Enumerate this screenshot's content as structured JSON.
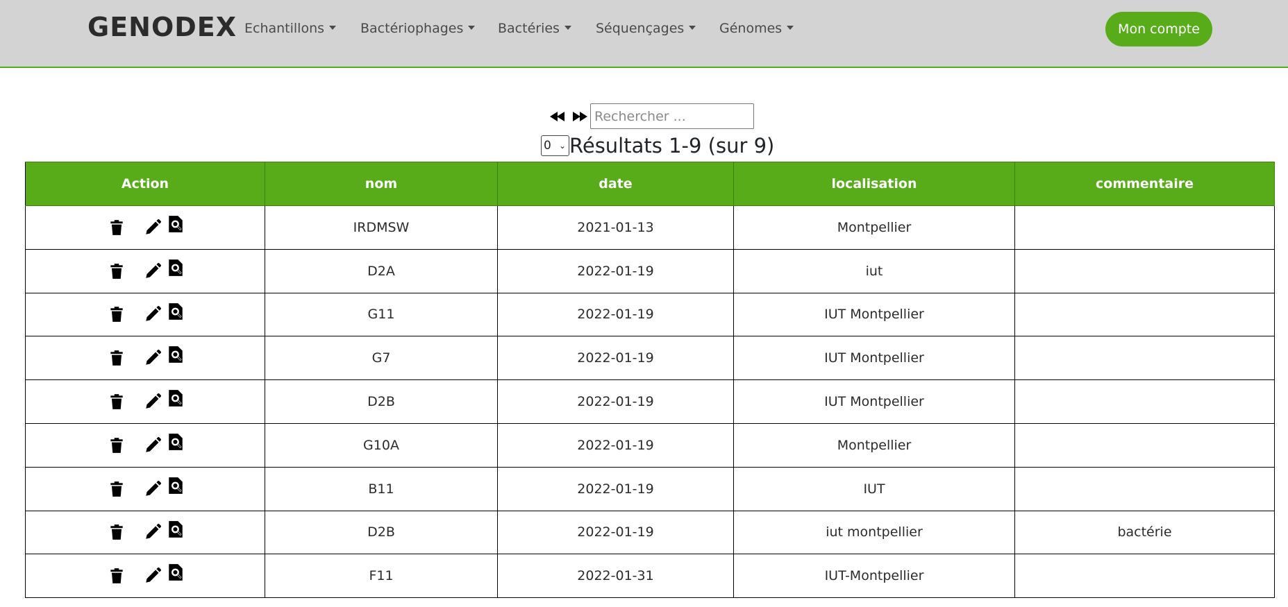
{
  "app": {
    "brand": "GENODEX"
  },
  "nav": {
    "items": [
      {
        "label": "Echantillons"
      },
      {
        "label": "Bactériophages"
      },
      {
        "label": "Bactéries"
      },
      {
        "label": "Séquençages"
      },
      {
        "label": "Génomes"
      }
    ],
    "account_label": "Mon compte"
  },
  "pager": {
    "prev_icon": "double-arrow-left-icon",
    "next_icon": "double-arrow-right-icon",
    "search_placeholder": "Rechercher ...",
    "page_value": "0",
    "results_text": "Résultats 1-9 (sur 9)"
  },
  "table": {
    "headers": [
      "Action",
      "nom",
      "date",
      "localisation",
      "commentaire"
    ],
    "action_icons": [
      "trash-icon",
      "pencil-icon",
      "file-search-icon"
    ],
    "rows": [
      {
        "nom": "IRDMSW",
        "date": "2021-01-13",
        "localisation": "Montpellier",
        "commentaire": ""
      },
      {
        "nom": "D2A",
        "date": "2022-01-19",
        "localisation": "iut",
        "commentaire": ""
      },
      {
        "nom": "G11",
        "date": "2022-01-19",
        "localisation": "IUT Montpellier",
        "commentaire": ""
      },
      {
        "nom": "G7",
        "date": "2022-01-19",
        "localisation": "IUT Montpellier",
        "commentaire": ""
      },
      {
        "nom": "D2B",
        "date": "2022-01-19",
        "localisation": "IUT Montpellier",
        "commentaire": ""
      },
      {
        "nom": "G10A",
        "date": "2022-01-19",
        "localisation": "Montpellier",
        "commentaire": ""
      },
      {
        "nom": "B11",
        "date": "2022-01-19",
        "localisation": "IUT",
        "commentaire": ""
      },
      {
        "nom": "D2B",
        "date": "2022-01-19",
        "localisation": "iut montpellier",
        "commentaire": "bactérie"
      },
      {
        "nom": "F11",
        "date": "2022-01-31",
        "localisation": "IUT-Montpellier",
        "commentaire": ""
      }
    ]
  },
  "colors": {
    "accent": "#58ab19",
    "navbar_bg": "#d3d3d3",
    "header_text": "#ffffff"
  }
}
